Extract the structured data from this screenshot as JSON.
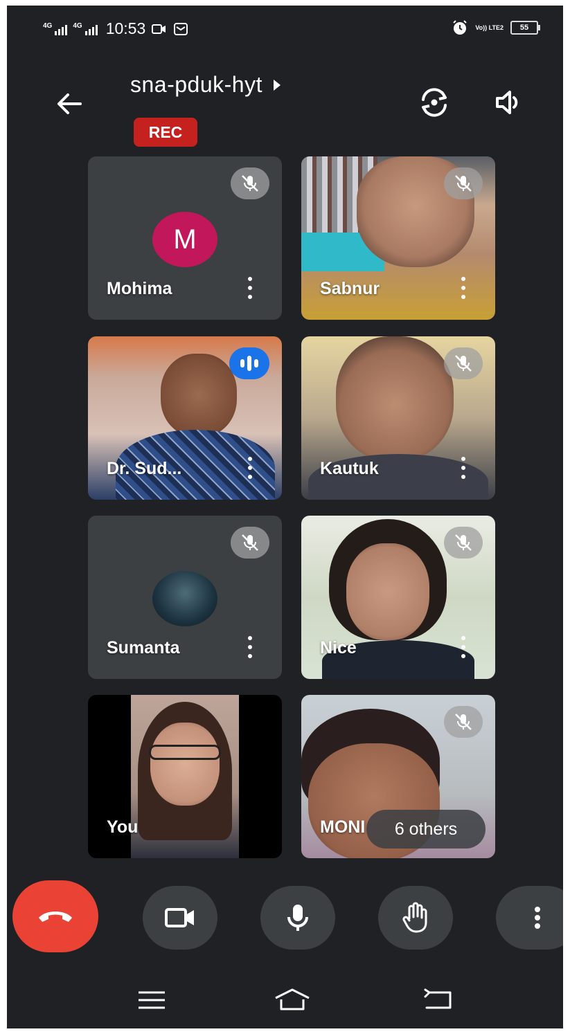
{
  "status_bar": {
    "network1": "4G",
    "network2": "4G",
    "time": "10:53",
    "volte": "Vo)) LTE2",
    "battery": "55"
  },
  "header": {
    "meeting_code": "sna-pduk-hyt",
    "rec_label": "REC"
  },
  "participants": [
    {
      "name": "Mohima",
      "initial": "M",
      "muted": true
    },
    {
      "name": "Sabnur",
      "muted": true
    },
    {
      "name": "Dr. Sud...",
      "speaking": true
    },
    {
      "name": "Kautuk",
      "muted": true
    },
    {
      "name": "Sumanta",
      "muted": true
    },
    {
      "name": "Nice",
      "muted": true
    },
    {
      "name": "You"
    },
    {
      "name": "MONI",
      "muted": true
    }
  ],
  "others_label": "6 others",
  "controls": [
    "hang-up",
    "camera",
    "microphone",
    "raise-hand",
    "more-options"
  ],
  "colors": {
    "background": "#202124",
    "tile": "#3c4043",
    "rec": "#c5221f",
    "hangup": "#ea4335",
    "speaking": "#1a73e8",
    "avatar_m": "#c2185b"
  }
}
